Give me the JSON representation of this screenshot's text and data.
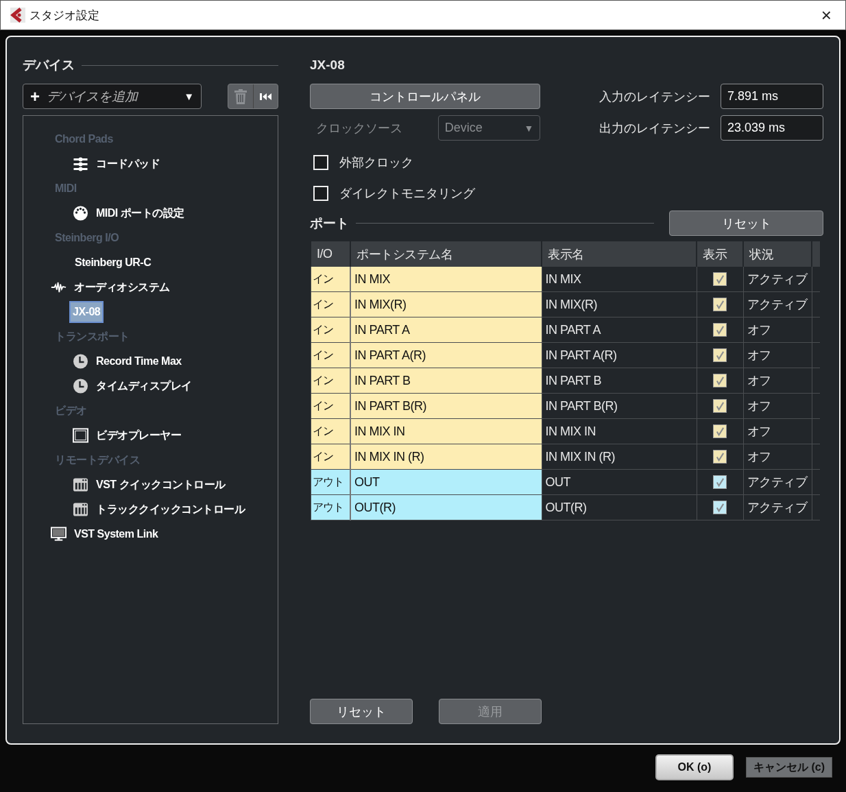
{
  "window": {
    "title": "スタジオ設定",
    "close": "×"
  },
  "devices": {
    "heading": "デバイス",
    "add_device": {
      "plus": "+",
      "placeholder": "デバイスを追加",
      "caret": "▼"
    },
    "tree": [
      {
        "label": "Chord Pads",
        "kind": "category",
        "selected": false,
        "children": [
          {
            "label": "コードパッド",
            "kind": "faders",
            "selected": false
          }
        ]
      },
      {
        "label": "MIDI",
        "kind": "category",
        "selected": false,
        "children": [
          {
            "label": "MIDI ポートの設定",
            "kind": "midi",
            "selected": false
          }
        ]
      },
      {
        "label": "Steinberg I/O",
        "kind": "category",
        "selected": false,
        "children": [
          {
            "label": "Steinberg UR-C",
            "kind": "plain",
            "selected": false
          }
        ]
      },
      {
        "label": "オーディオシステム",
        "kind": "audio",
        "selected": false,
        "children": [
          {
            "label": "JX-08",
            "kind": "plain",
            "selected": true
          }
        ]
      },
      {
        "label": "トランスポート",
        "kind": "category",
        "selected": false,
        "children": [
          {
            "label": "Record Time Max",
            "kind": "clock",
            "selected": false
          },
          {
            "label": "タイムディスプレイ",
            "kind": "clock",
            "selected": false
          }
        ]
      },
      {
        "label": "ビデオ",
        "kind": "category",
        "selected": false,
        "children": [
          {
            "label": "ビデオプレーヤー",
            "kind": "film",
            "selected": false
          }
        ]
      },
      {
        "label": "リモートデバイス",
        "kind": "category",
        "selected": false,
        "children": [
          {
            "label": "VST クイックコントロール",
            "kind": "controller",
            "selected": false
          },
          {
            "label": "トラッククイックコントロール",
            "kind": "controller",
            "selected": false
          }
        ]
      },
      {
        "label": "VST System Link",
        "kind": "monitor",
        "selected": false
      }
    ]
  },
  "settings": {
    "title": "JX-08",
    "control_panel": "コントロールパネル",
    "clock_source": {
      "label": "クロックソース",
      "value": "Device",
      "caret": "▼",
      "disabled": true
    },
    "input_latency": {
      "label": "入力のレイテンシー",
      "value": "7.891 ms"
    },
    "output_latency": {
      "label": "出力のレイテンシー",
      "value": "23.039 ms"
    },
    "options": [
      {
        "label": "外部クロック",
        "checked": false
      },
      {
        "label": "ダイレクトモニタリング",
        "checked": false
      }
    ],
    "ports_heading": "ポート",
    "ports_reset": "リセット",
    "table": {
      "columns": [
        "I/O",
        "ポートシステム名",
        "表示名",
        "表示",
        "状況"
      ],
      "rows": [
        {
          "kind": "in",
          "io": "イン",
          "system_name": "IN MIX",
          "display_name": "IN MIX",
          "visible": true,
          "status": "アクティブ"
        },
        {
          "kind": "in",
          "io": "イン",
          "system_name": "IN MIX(R)",
          "display_name": "IN MIX(R)",
          "visible": true,
          "status": "アクティブ"
        },
        {
          "kind": "in",
          "io": "イン",
          "system_name": "IN PART A",
          "display_name": "IN PART A",
          "visible": true,
          "status": "オフ"
        },
        {
          "kind": "in",
          "io": "イン",
          "system_name": "IN PART A(R)",
          "display_name": "IN PART A(R)",
          "visible": true,
          "status": "オフ"
        },
        {
          "kind": "in",
          "io": "イン",
          "system_name": "IN PART B",
          "display_name": "IN PART B",
          "visible": true,
          "status": "オフ"
        },
        {
          "kind": "in",
          "io": "イン",
          "system_name": "IN PART B(R)",
          "display_name": "IN PART B(R)",
          "visible": true,
          "status": "オフ"
        },
        {
          "kind": "in",
          "io": "イン",
          "system_name": "IN MIX IN",
          "display_name": "IN MIX IN",
          "visible": true,
          "status": "オフ"
        },
        {
          "kind": "in",
          "io": "イン",
          "system_name": "IN MIX IN (R)",
          "display_name": "IN MIX IN (R)",
          "visible": true,
          "status": "オフ"
        },
        {
          "kind": "out",
          "io": "アウト",
          "system_name": "OUT",
          "display_name": "OUT",
          "visible": true,
          "status": "アクティブ"
        },
        {
          "kind": "out",
          "io": "アウト",
          "system_name": "OUT(R)",
          "display_name": "OUT(R)",
          "visible": true,
          "status": "アクティブ"
        }
      ]
    },
    "reset": "リセット",
    "apply": {
      "label": "適用",
      "disabled": true
    }
  },
  "footer": {
    "ok": "OK (o)",
    "cancel": "キャンセル (c)"
  }
}
